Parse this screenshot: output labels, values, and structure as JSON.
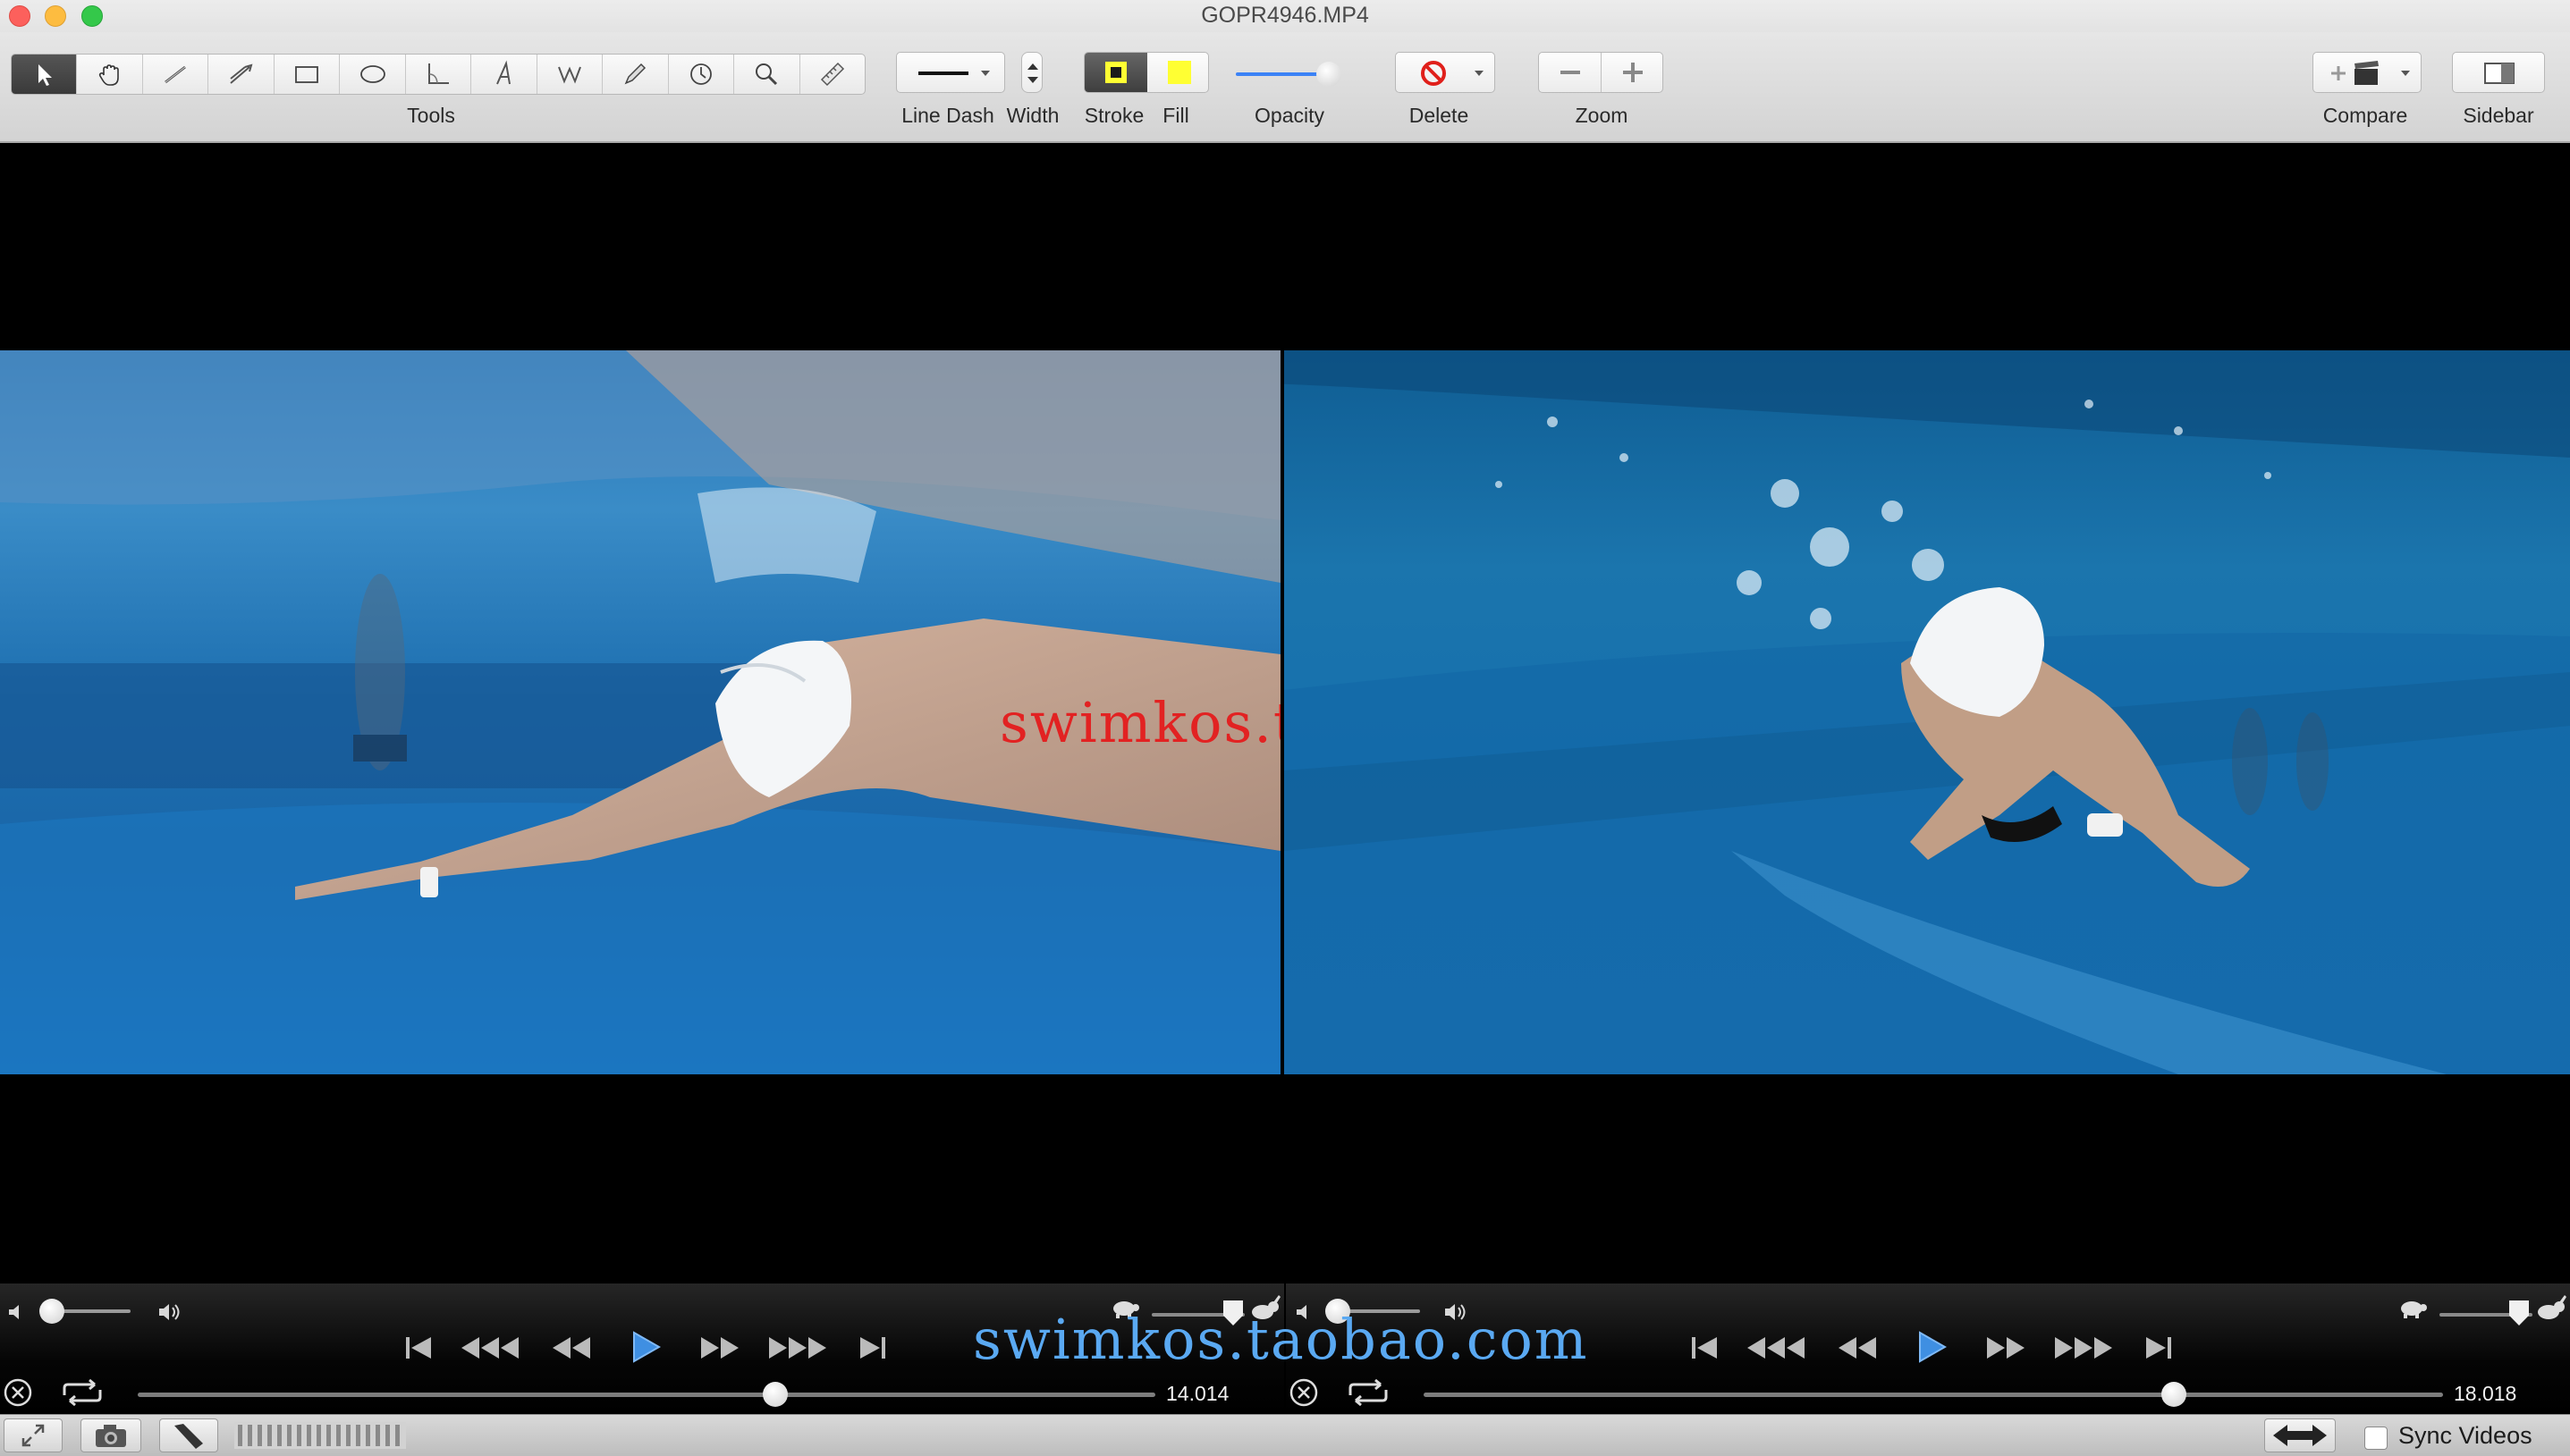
{
  "window": {
    "title": "GOPR4946.MP4"
  },
  "toolbar": {
    "groups": {
      "tools": "Tools",
      "line_dash": "Line Dash",
      "width": "Width",
      "stroke": "Stroke",
      "fill": "Fill",
      "opacity": "Opacity",
      "delete": "Delete",
      "zoom": "Zoom",
      "compare": "Compare",
      "sidebar": "Sidebar"
    },
    "tools": [
      "arrow-pointer-icon",
      "hand-icon",
      "line-icon",
      "double-line-icon",
      "rectangle-icon",
      "ellipse-icon",
      "angle-icon",
      "text-icon",
      "polyline-icon",
      "pencil-icon",
      "clock-icon",
      "magnifier-icon",
      "ruler-icon"
    ],
    "active_tool": "arrow-pointer-icon",
    "stroke_color": "#1a1a1a",
    "fill_color": "#ffff33",
    "opacity_level": 0.9
  },
  "videos": {
    "watermark": "swimkos.taobao.com"
  },
  "players": {
    "left": {
      "time": "14.014",
      "position": 0.628,
      "volume": 0.0,
      "speed": 0.85
    },
    "right": {
      "time": "18.018",
      "position": 0.738,
      "volume": 0.0,
      "speed": 0.85
    },
    "watermark": "swimkos.taobao.com"
  },
  "statusbar": {
    "sync_label": "Sync Videos",
    "sync_checked": false
  }
}
